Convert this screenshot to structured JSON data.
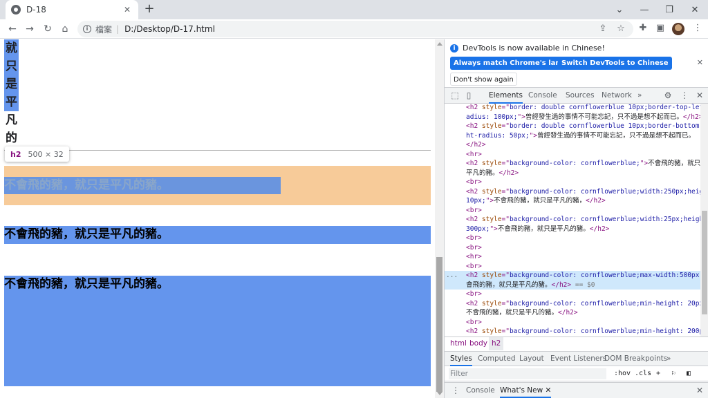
{
  "browser": {
    "tab_title": "D-18",
    "tab_close": "✕",
    "new_tab": "+",
    "win_min": "⌄",
    "win_minimize": "—",
    "win_restore": "❐",
    "win_close": "✕",
    "nav_back": "←",
    "nav_forward": "→",
    "nav_reload": "↻",
    "nav_home": "⌂",
    "omnibox_label": "檔案",
    "omnibox_sep": "|",
    "url": "D:/Desktop/D-17.html"
  },
  "page": {
    "vertical_chars": [
      {
        "ch": "就",
        "hl": true
      },
      {
        "ch": "只",
        "hl": true
      },
      {
        "ch": "是",
        "hl": true
      },
      {
        "ch": "平",
        "hl": true
      },
      {
        "ch": "凡",
        "hl": false
      },
      {
        "ch": "的",
        "hl": false
      }
    ],
    "tooltip_tag": "h2",
    "tooltip_dims": "500 × 32",
    "h2_highlighted": "不會飛的豬，就只是平凡的豬。",
    "h2_min_height": "不會飛的豬，就只是平凡的豬。",
    "h2_min_height_200": "不會飛的豬，就只是平凡的豬。"
  },
  "devtools": {
    "notice_text": "DevTools is now available in Chinese!",
    "btn_match": "Always match Chrome's language",
    "btn_switch": "Switch DevTools to Chinese",
    "btn_dont_show": "Don't show again",
    "notice_close": "✕",
    "tabs": [
      "Elements",
      "Console",
      "Sources",
      "Network"
    ],
    "more_tabs": "»",
    "crumbs": [
      "html",
      "body",
      "h2"
    ],
    "subtabs": [
      "Styles",
      "Computed",
      "Layout",
      "Event Listeners",
      "DOM Breakpoints"
    ],
    "subtabs_more": "»",
    "filter_placeholder": "Filter",
    "filter_hov": ":hov",
    "filter_cls": ".cls",
    "filter_plus": "+",
    "drawer_tabs": [
      "Console",
      "What's New"
    ],
    "drawer_tab_close": "✕",
    "drawer_close": "✕",
    "selected_marker": "== $0",
    "dots": "..."
  },
  "colors": {
    "cornflowerblue": "#6495ed",
    "margin_overlay": "#f7cb99",
    "accent": "#1a73e8"
  }
}
